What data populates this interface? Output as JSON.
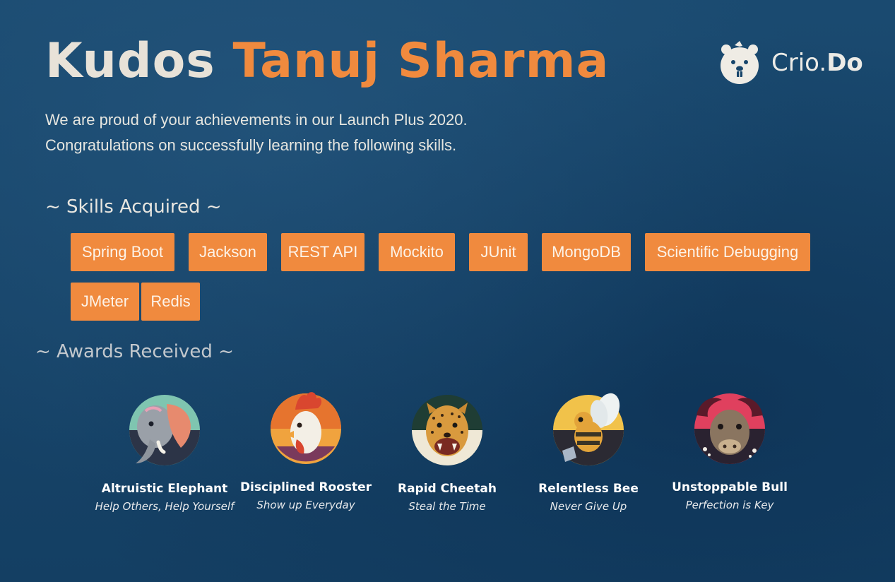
{
  "header": {
    "title_prefix": "Kudos",
    "recipient_name": "Tanuj Sharma"
  },
  "logo": {
    "text_main": "Crio.",
    "text_bold": "Do",
    "icon": "beaver-mascot-icon"
  },
  "intro": {
    "line1": "We are proud of your achievements in our Launch Plus 2020.",
    "line2": "Congratulations on successfully learning the following skills."
  },
  "skills": {
    "heading": "~ Skills Acquired ~",
    "items": [
      "Spring Boot",
      "Jackson",
      "REST API",
      "Mockito",
      "JUnit",
      "MongoDB",
      "Scientific Debugging",
      "JMeter",
      "Redis"
    ]
  },
  "awards": {
    "heading": "~ Awards Received ~",
    "items": [
      {
        "name": "Altruistic Elephant",
        "motto": "Help Others, Help Yourself",
        "icon": "elephant-icon"
      },
      {
        "name": "Disciplined Rooster",
        "motto": "Show up Everyday",
        "icon": "rooster-icon"
      },
      {
        "name": "Rapid Cheetah",
        "motto": "Steal the Time",
        "icon": "cheetah-icon"
      },
      {
        "name": "Relentless Bee",
        "motto": "Never Give Up",
        "icon": "bee-icon"
      },
      {
        "name": "Unstoppable Bull",
        "motto": "Perfection is Key",
        "icon": "bull-icon"
      }
    ]
  },
  "colors": {
    "background": "#17456b",
    "accent": "#f08a3e",
    "text": "#e8e4dc"
  }
}
